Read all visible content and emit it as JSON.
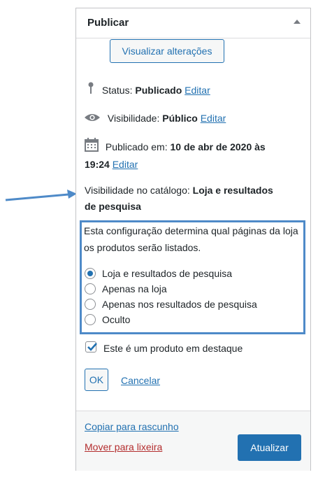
{
  "publish_box": {
    "title": "Publicar",
    "preview_label": "Visualizar alterações",
    "status_label": "Status:",
    "status_value": "Publicado",
    "status_edit": "Editar",
    "visibility_label": "Visibilidade:",
    "visibility_value": "Público",
    "visibility_edit": "Editar",
    "published_label": "Publicado em:",
    "published_date": "10 de abr de 2020 às",
    "published_time": "19:24",
    "published_edit": "Editar",
    "catalog_label": "Visibilidade no catálogo:",
    "catalog_value_1": "Loja e resultados",
    "catalog_value_2": "de pesquisa"
  },
  "catalog_settings": {
    "description": "Esta configuração determina qual páginas da loja os produtos serão listados.",
    "options": [
      {
        "label": "Loja e resultados de pesquisa",
        "checked": true
      },
      {
        "label": "Apenas na loja",
        "checked": false
      },
      {
        "label": "Apenas nos resultados de pesquisa",
        "checked": false
      },
      {
        "label": "Oculto",
        "checked": false
      }
    ],
    "featured_label": "Este é um produto em destaque",
    "featured_checked": true,
    "ok_label": "OK",
    "cancel_label": "Cancelar"
  },
  "footer": {
    "copy_draft": "Copiar para rascunho",
    "trash": "Mover para lixeira",
    "update_label": "Atualizar"
  },
  "colors": {
    "accent": "#2271b1",
    "highlight_border": "#4e8ac8",
    "danger": "#b32d2e"
  }
}
